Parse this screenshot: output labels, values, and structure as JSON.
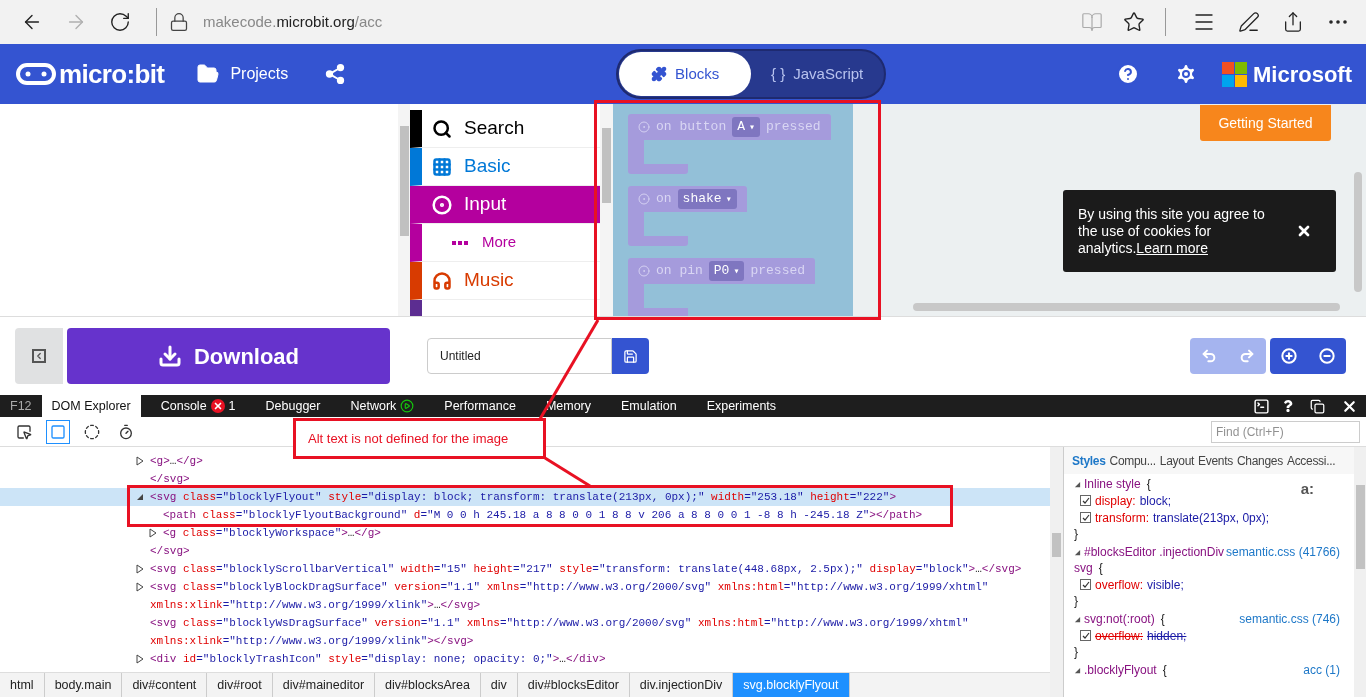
{
  "browser": {
    "nav": [
      {
        "kind": "back",
        "disabled": false
      },
      {
        "kind": "forward",
        "disabled": true
      },
      {
        "kind": "refresh",
        "disabled": false
      }
    ],
    "url": [
      {
        "text": "makecode.",
        "emphasis": false
      },
      {
        "text": "microbit.org",
        "emphasis": true
      },
      {
        "text": "/acc",
        "emphasis": false
      }
    ]
  },
  "header": {
    "logo": "micro:bit",
    "projects": "Projects",
    "modes": [
      {
        "kind": "blocks",
        "label": "Blocks",
        "selected": true
      },
      {
        "kind": "javascript",
        "glyph": "{ }",
        "label": "JavaScript",
        "selected": false
      }
    ],
    "brand": "Microsoft"
  },
  "toolbox": [
    {
      "kind": "category",
      "label": "Search",
      "color": "#000000",
      "selected": false
    },
    {
      "kind": "category",
      "label": "Basic",
      "color": "#0078d7",
      "selected": false
    },
    {
      "kind": "category",
      "label": "Input",
      "color": "#b4009e",
      "selected": true
    },
    {
      "kind": "sub",
      "label": "More",
      "color": "#b4009e",
      "selected": false
    },
    {
      "kind": "category",
      "label": "Music",
      "color": "#d83b01",
      "selected": false
    },
    {
      "kind": "category",
      "color": "#5c2d91",
      "selected": false
    }
  ],
  "flyout": [
    {
      "parts": [
        {
          "kind": "text",
          "text": "on button"
        },
        {
          "kind": "dropdown",
          "text": "A",
          "caret": "▾"
        },
        {
          "kind": "text",
          "text": "pressed"
        }
      ]
    },
    {
      "parts": [
        {
          "kind": "text",
          "text": "on"
        },
        {
          "kind": "dropdown",
          "text": "shake",
          "caret": "▾"
        }
      ]
    },
    {
      "parts": [
        {
          "kind": "text",
          "text": "on pin"
        },
        {
          "kind": "dropdown",
          "text": "P0",
          "caret": "▾"
        },
        {
          "kind": "text",
          "text": "pressed"
        }
      ]
    }
  ],
  "workspace": {
    "getting_started": "Getting Started",
    "cookie": {
      "text": "By using this site you agree to the use of cookies for analytics.",
      "link": "Learn more"
    }
  },
  "bottom_bar": {
    "download": "Download",
    "project_name": "Untitled",
    "undo_disabled": true,
    "redo_disabled": true
  },
  "devtools": {
    "tabs": [
      {
        "kind": "f12",
        "label": "F12",
        "selected": false
      },
      {
        "kind": "plain",
        "label": "DOM Explorer",
        "selected": true
      },
      {
        "kind": "errors",
        "label": "Console",
        "badge": "1",
        "selected": false
      },
      {
        "kind": "plain",
        "label": "Debugger",
        "selected": false
      },
      {
        "kind": "network",
        "label": "Network",
        "selected": false
      },
      {
        "kind": "plain",
        "label": "Performance",
        "selected": false
      },
      {
        "kind": "plain",
        "label": "Memory",
        "selected": false
      },
      {
        "kind": "plain",
        "label": "Emulation",
        "selected": false
      },
      {
        "kind": "plain",
        "label": "Experiments",
        "selected": false
      }
    ],
    "tools": [
      {
        "kind": "select",
        "selected": false
      },
      {
        "kind": "highlight",
        "selected": true
      },
      {
        "kind": "circle",
        "selected": false
      },
      {
        "kind": "timer",
        "selected": false
      }
    ],
    "find_placeholder": "Find (Ctrl+F)",
    "dom_tree": [
      {
        "children": [
          {
            "expanded": false,
            "selected": false,
            "lines": [
              [
                {
                  "kind": "tag",
                  "text": "<g>"
                },
                {
                  "kind": "text",
                  "text": "…"
                },
                {
                  "kind": "tag",
                  "text": "</g>"
                }
              ]
            ]
          }
        ]
      },
      {
        "selected": false,
        "lines": [
          [
            {
              "kind": "tag",
              "text": "</svg>"
            }
          ]
        ]
      },
      {
        "expanded": true,
        "selected": true,
        "lines": [
          [
            {
              "kind": "tag",
              "text": "<svg"
            },
            {
              "kind": "attr",
              "text": " class"
            },
            {
              "kind": "value",
              "text": "=\"blocklyFlyout\""
            },
            {
              "kind": "attr",
              "text": " style"
            },
            {
              "kind": "value",
              "text": "=\"display: block; transform: translate(213px, 0px);\""
            },
            {
              "kind": "attr",
              "text": " width"
            },
            {
              "kind": "value",
              "text": "=\"253.18\""
            },
            {
              "kind": "attr",
              "text": " height"
            },
            {
              "kind": "value",
              "text": "=\"222\""
            },
            {
              "kind": "tag",
              "text": ">"
            }
          ]
        ],
        "children": [
          {
            "selected": false,
            "lines": [
              [
                {
                  "kind": "tag",
                  "text": "<path"
                },
                {
                  "kind": "attr",
                  "text": " class"
                },
                {
                  "kind": "value",
                  "text": "=\"blocklyFlyoutBackground\""
                },
                {
                  "kind": "attr",
                  "text": " d"
                },
                {
                  "kind": "value",
                  "text": "=\"M 0 0 h 245.18 a 8 8 0 0 1 8 8 v 206 a 8 8 0 0 1 -8 8 h -245.18 Z\""
                },
                {
                  "kind": "tag",
                  "text": "></path>"
                }
              ]
            ]
          },
          {
            "expanded": false,
            "selected": false,
            "lines": [
              [
                {
                  "kind": "tag",
                  "text": "<g"
                },
                {
                  "kind": "attr",
                  "text": " class"
                },
                {
                  "kind": "value",
                  "text": "=\"blocklyWorkspace\""
                },
                {
                  "kind": "tag",
                  "text": ">"
                },
                {
                  "kind": "text",
                  "text": "…"
                },
                {
                  "kind": "tag",
                  "text": "</g>"
                }
              ]
            ]
          }
        ]
      },
      {
        "selected": false,
        "lines": [
          [
            {
              "kind": "tag",
              "text": "</svg>"
            }
          ]
        ]
      },
      {
        "expanded": false,
        "selected": false,
        "lines": [
          [
            {
              "kind": "tag",
              "text": "<svg"
            },
            {
              "kind": "attr",
              "text": " class"
            },
            {
              "kind": "value",
              "text": "=\"blocklyScrollbarVertical\""
            },
            {
              "kind": "attr",
              "text": " width"
            },
            {
              "kind": "value",
              "text": "=\"15\""
            },
            {
              "kind": "attr",
              "text": " height"
            },
            {
              "kind": "value",
              "text": "=\"217\""
            },
            {
              "kind": "attr",
              "text": " style"
            },
            {
              "kind": "value",
              "text": "=\"transform: translate(448.68px, 2.5px);\""
            },
            {
              "kind": "attr",
              "text": " display"
            },
            {
              "kind": "value",
              "text": "=\"block\""
            },
            {
              "kind": "tag",
              "text": ">"
            },
            {
              "kind": "text",
              "text": "…"
            },
            {
              "kind": "tag",
              "text": "</svg>"
            }
          ]
        ]
      },
      {
        "expanded": false,
        "selected": false,
        "lines": [
          [
            {
              "kind": "tag",
              "text": "<svg"
            },
            {
              "kind": "attr",
              "text": " class"
            },
            {
              "kind": "value",
              "text": "=\"blocklyBlockDragSurface\""
            },
            {
              "kind": "attr",
              "text": " version"
            },
            {
              "kind": "value",
              "text": "=\"1.1\""
            },
            {
              "kind": "attr",
              "text": " xmlns"
            },
            {
              "kind": "value",
              "text": "=\"http://www.w3.org/2000/svg\""
            },
            {
              "kind": "attr",
              "text": " xmlns:html"
            },
            {
              "kind": "value",
              "text": "=\"http://www.w3.org/1999/xhtml\""
            }
          ],
          [
            {
              "kind": "attr",
              "text": "xmlns:xlink"
            },
            {
              "kind": "value",
              "text": "=\"http://www.w3.org/1999/xlink\""
            },
            {
              "kind": "tag",
              "text": ">"
            },
            {
              "kind": "text",
              "text": "…"
            },
            {
              "kind": "tag",
              "text": "</svg>"
            }
          ]
        ]
      },
      {
        "selected": false,
        "lines": [
          [
            {
              "kind": "tag",
              "text": "<svg"
            },
            {
              "kind": "attr",
              "text": " class"
            },
            {
              "kind": "value",
              "text": "=\"blocklyWsDragSurface\""
            },
            {
              "kind": "attr",
              "text": " version"
            },
            {
              "kind": "value",
              "text": "=\"1.1\""
            },
            {
              "kind": "attr",
              "text": " xmlns"
            },
            {
              "kind": "value",
              "text": "=\"http://www.w3.org/2000/svg\""
            },
            {
              "kind": "attr",
              "text": " xmlns:html"
            },
            {
              "kind": "value",
              "text": "=\"http://www.w3.org/1999/xhtml\""
            }
          ],
          [
            {
              "kind": "attr",
              "text": "xmlns:xlink"
            },
            {
              "kind": "value",
              "text": "=\"http://www.w3.org/1999/xlink\""
            },
            {
              "kind": "tag",
              "text": "></svg>"
            }
          ]
        ]
      },
      {
        "expanded": false,
        "selected": false,
        "lines": [
          [
            {
              "kind": "tag",
              "text": "<div"
            },
            {
              "kind": "attr",
              "text": " id"
            },
            {
              "kind": "value",
              "text": "=\"blocklyTrashIcon\""
            },
            {
              "kind": "attr",
              "text": " style"
            },
            {
              "kind": "value",
              "text": "=\"display: none; opacity: 0;\""
            },
            {
              "kind": "tag",
              "text": ">"
            },
            {
              "kind": "text",
              "text": "…"
            },
            {
              "kind": "tag",
              "text": "</div>"
            }
          ]
        ]
      }
    ],
    "breadcrumb": [
      {
        "label": "html",
        "selected": false
      },
      {
        "label": "body.main",
        "selected": false
      },
      {
        "label": "div#content",
        "selected": false
      },
      {
        "label": "div#root",
        "selected": false
      },
      {
        "label": "div#maineditor",
        "selected": false
      },
      {
        "label": "div#blocksArea",
        "selected": false
      },
      {
        "label": "div",
        "selected": false
      },
      {
        "label": "div#blocksEditor",
        "selected": false
      },
      {
        "label": "div.injectionDiv",
        "selected": false
      },
      {
        "label": "svg.blocklyFlyout",
        "selected": true
      }
    ],
    "styles": {
      "tabs": [
        {
          "label": "Styles",
          "selected": true
        },
        {
          "label": "Compu...",
          "selected": false
        },
        {
          "label": "Layout",
          "selected": false
        },
        {
          "label": "Events",
          "selected": false
        },
        {
          "label": "Changes",
          "selected": false
        },
        {
          "label": "Accessi...",
          "selected": false
        }
      ],
      "font_toggle": "a:",
      "open": "{",
      "close": "}",
      "rules": [
        {
          "selectors": [
            "Inline style"
          ],
          "declarations": [
            {
              "prop": "display:",
              "value": "block;",
              "checked": true,
              "overridden": false
            },
            {
              "prop": "transform:",
              "value": "translate(213px, 0px);",
              "checked": true,
              "overridden": false
            }
          ]
        },
        {
          "selectors": [
            "#blocksEditor .injectionDiv",
            "svg"
          ],
          "source": "semantic.css (41766)",
          "declarations": [
            {
              "prop": "overflow:",
              "value": "visible;",
              "checked": true,
              "overridden": false
            }
          ]
        },
        {
          "selectors": [
            "svg:not(:root)"
          ],
          "source": "semantic.css (746)",
          "declarations": [
            {
              "prop": "overflow:",
              "value": "hidden;",
              "checked": true,
              "overridden": true
            }
          ]
        },
        {
          "selectors": [
            ".blocklyFlyout"
          ],
          "source": "acc (1)"
        }
      ]
    }
  },
  "annotations": {
    "callout": "Alt text is not defined for the image"
  }
}
